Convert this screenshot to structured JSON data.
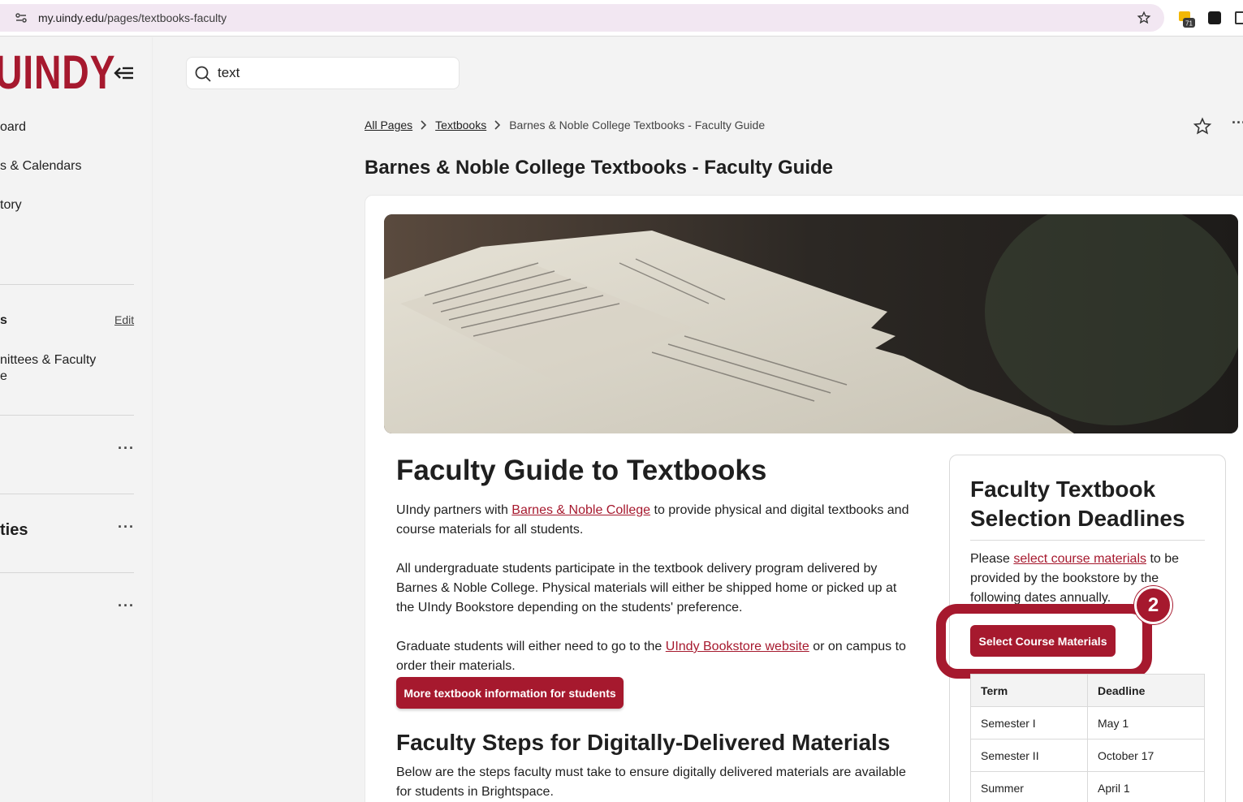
{
  "browser": {
    "url_host": "my.uindy.edu",
    "url_path": "/pages/textbooks-faculty",
    "extension_badge": "71"
  },
  "sidebar": {
    "logo_text": "UINDY",
    "nav_items": [
      {
        "label": "oard"
      },
      {
        "label": "s & Calendars"
      },
      {
        "label": "tory"
      }
    ],
    "favorites_title": "s",
    "favorites_edit": "Edit",
    "favorite_item_line1": "nittees & Faculty",
    "favorite_item_line2": "e",
    "section_ties": "ties",
    "more_label": "···"
  },
  "search": {
    "value": "text"
  },
  "breadcrumb": {
    "all_pages": "All Pages",
    "textbooks": "Textbooks",
    "current": "Barnes & Noble College Textbooks - Faculty Guide"
  },
  "page": {
    "title": "Barnes & Noble College Textbooks - Faculty Guide",
    "more_label": "···"
  },
  "content": {
    "heading": "Faculty Guide to Textbooks",
    "p1_before": "UIndy partners with ",
    "p1_link": "Barnes & Noble College",
    "p1_after": " to provide physical and digital textbooks and course materials for all students.",
    "p2": "All undergraduate students participate in the textbook delivery program delivered by Barnes & Noble College. Physical materials will either be shipped home or picked up at the UIndy Bookstore depending on the students' preference.",
    "p3_before": "Graduate students will either need to go to the ",
    "p3_link": "UIndy Bookstore website",
    "p3_after": " or on campus to order their materials.",
    "students_button": "More textbook information for students",
    "heading2": "Faculty Steps for Digitally-Delivered Materials",
    "p4": "Below are the steps faculty must take to ensure digitally delivered materials are available for students in Brightspace."
  },
  "panel": {
    "title": "Faculty Textbook Selection Deadlines",
    "text_before": "Please ",
    "text_link": "select course materials",
    "text_after": " to be provided by the bookstore by the following dates annually.",
    "select_button": "Select Course Materials",
    "step_number": "2",
    "table_headers": [
      "Term",
      "Deadline"
    ],
    "table_rows": [
      [
        "Semester I",
        "May 1"
      ],
      [
        "Semester II",
        "October 17"
      ],
      [
        "Summer",
        "April 1"
      ]
    ]
  },
  "colors": {
    "brand": "#a6192e",
    "url_bar": "#f2e7f2"
  }
}
